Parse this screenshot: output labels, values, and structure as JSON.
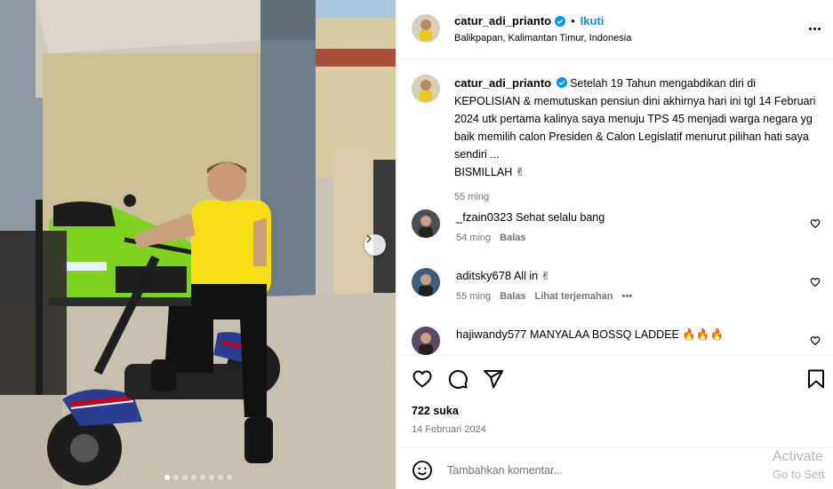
{
  "post": {
    "author": "catur_adi_prianto",
    "follow_label": "Ikuti",
    "separator": "•",
    "location": "Balikpapan, Kalimantan Timur, Indonesia",
    "caption": "Setelah 19 Tahun mengabdikan diri di KEPOLISIAN & memutuskan pensiun dini akhirnya hari ini tgl 14 Februari 2024 utk pertama kalinya saya menuju TPS 45 menjadi warga negara yg baik memilih calon Presiden & Calon Legislatif menurut pilihan hati saya sendiri ...",
    "caption_tail": "BISMILLAH ✌",
    "caption_time": "55 ming",
    "likes": "722 suka",
    "date": "14 Februari 2024",
    "photo_count": 8,
    "active_photo": 1
  },
  "comments": [
    {
      "username": "_fzain0323",
      "text": "Sehat selalu bang",
      "time": "54 ming",
      "reply": "Balas",
      "translate": "",
      "more": ""
    },
    {
      "username": "aditsky678",
      "text": "All in ✌",
      "time": "55 ming",
      "reply": "Balas",
      "translate": "Lihat terjemahan",
      "more": "•••"
    },
    {
      "username": "hajiwandy577",
      "text": "MANYALAA BOSSQ LADDEE 🔥🔥🔥",
      "time": "",
      "reply": "",
      "translate": "",
      "more": ""
    }
  ],
  "composer": {
    "placeholder": "Tambahkan komentar..."
  },
  "watermark": {
    "line1": "Activate",
    "line2": "Go to Sett"
  },
  "colors": {
    "accent": "#0095f6",
    "muted": "#737373",
    "divider": "#efefef",
    "verified": "#0095f6"
  },
  "icons": [
    "verified-icon",
    "more-icon",
    "heart-icon",
    "comment-icon",
    "share-icon",
    "bookmark-icon",
    "emoji-icon",
    "chevron-right-icon"
  ]
}
